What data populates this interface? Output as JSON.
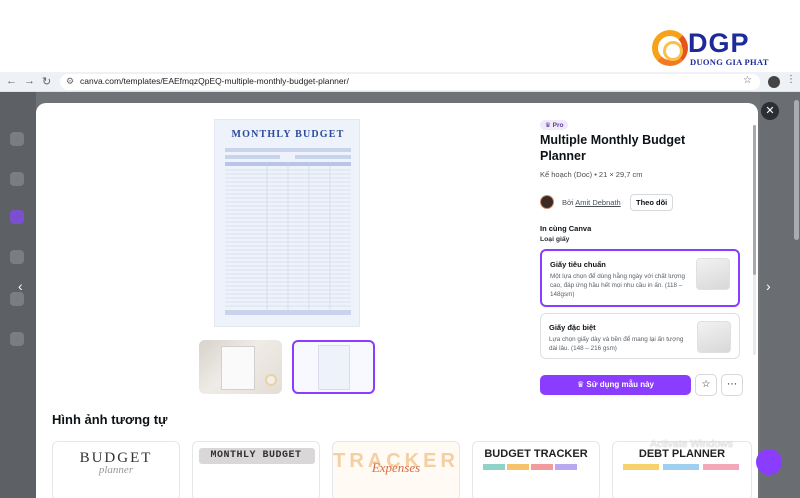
{
  "banner": {
    "brand_main": "DGP",
    "brand_sub": "DUONG GIA PHAT"
  },
  "browser": {
    "url": "canva.com/templates/EAEfmqzQpEQ-multiple-monthly-budget-planner/"
  },
  "preview": {
    "doc_title": "MONTHLY BUDGET"
  },
  "panel": {
    "badge": "Pro",
    "title": "Multiple Monthly Budget Planner",
    "meta": "Kế hoạch (Doc) • 21 × 29,7 cm",
    "author_prefix": "Bởi",
    "author_name": "Amit Debnath",
    "follow_label": "Theo dõi",
    "print_heading": "In cùng Canva",
    "paper_heading": "Loại giấy",
    "paper_options": [
      {
        "title": "Giấy tiêu chuẩn",
        "desc": "Một lựa chọn để dùng hằng ngày với chất lượng cao, đáp ứng hầu hết mọi nhu cầu in ấn. (118 – 148gsm)",
        "selected": true
      },
      {
        "title": "Giấy đặc biệt",
        "desc": "Lựa chọn giấy dày và bền để mang lại ấn tượng dài lâu. (148 – 216 gsm)",
        "selected": false
      }
    ],
    "use_label": "Sử dụng mẫu này"
  },
  "similar": {
    "heading": "Hình ảnh tương tự",
    "cards": [
      {
        "title": "BUDGET",
        "script": "planner"
      },
      {
        "title": "MONTHLY BUDGET",
        "script": ""
      },
      {
        "title": "TRACKER",
        "script": "Expenses"
      },
      {
        "title": "BUDGET TRACKER",
        "script": ""
      },
      {
        "title": "DEBT PLANNER",
        "script": ""
      }
    ]
  },
  "os": {
    "watermark": "Activate Windows"
  },
  "colors": {
    "accent": "#8b3dff",
    "brand_blue": "#1c2a9a",
    "brand_orange": "#f37a20",
    "backdrop": "#6f7378"
  }
}
